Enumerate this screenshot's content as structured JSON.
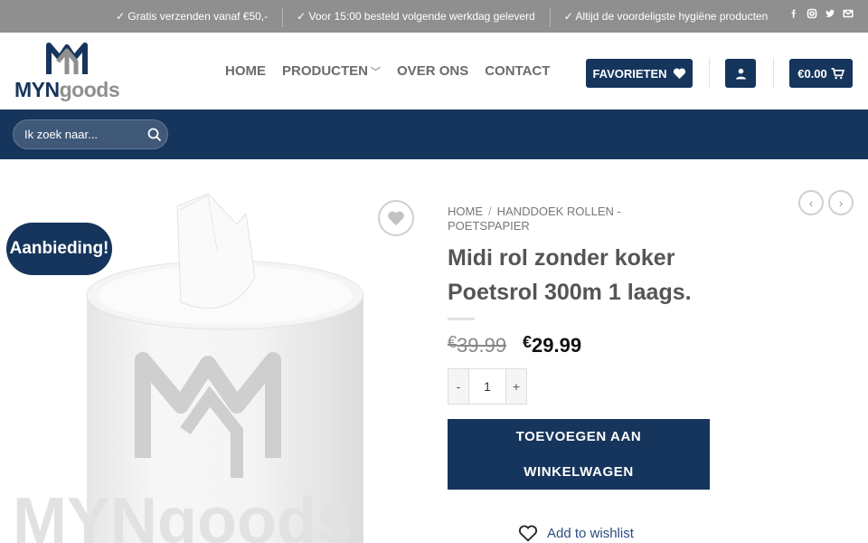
{
  "topbar": {
    "messages": [
      "✓ Gratis verzenden vanaf €50,-",
      "✓ Voor 15:00 besteld volgende werkdag geleverd",
      "✓ Altijd de voordeligste hygiëne producten"
    ],
    "social_icons": [
      "facebook-icon",
      "instagram-icon",
      "twitter-icon",
      "email-icon"
    ]
  },
  "brand": {
    "logo_text_1": "MYN",
    "logo_text_2": "goods"
  },
  "nav": {
    "items": [
      "HOME",
      "PRODUCTEN",
      "OVER ONS",
      "CONTACT"
    ]
  },
  "header": {
    "favorites_label": "FAVORIETEN",
    "cart_total": "€0.00"
  },
  "search": {
    "placeholder": "Ik zoek naar..."
  },
  "product": {
    "sale_badge": "Aanbieding!",
    "breadcrumb": [
      "HOME",
      "HANDDOEK ROLLEN - POETSPAPIER"
    ],
    "title_line1": "Midi rol zonder koker",
    "title_line2": "Poetsrol 300m 1 laags.",
    "currency": "€",
    "price_old": "39.99",
    "price_new": "29.99",
    "qty_minus": "-",
    "quantity": "1",
    "qty_plus": "+",
    "add_to_cart_line1": "TOEVOEGEN AAN",
    "add_to_cart_line2": "WINKELWAGEN",
    "wishlist_label": "Add to wishlist",
    "watermark": "MYNgoods"
  },
  "colors": {
    "primary": "#16355c",
    "topbar": "#8f8f8f",
    "link": "#2b4c80"
  }
}
